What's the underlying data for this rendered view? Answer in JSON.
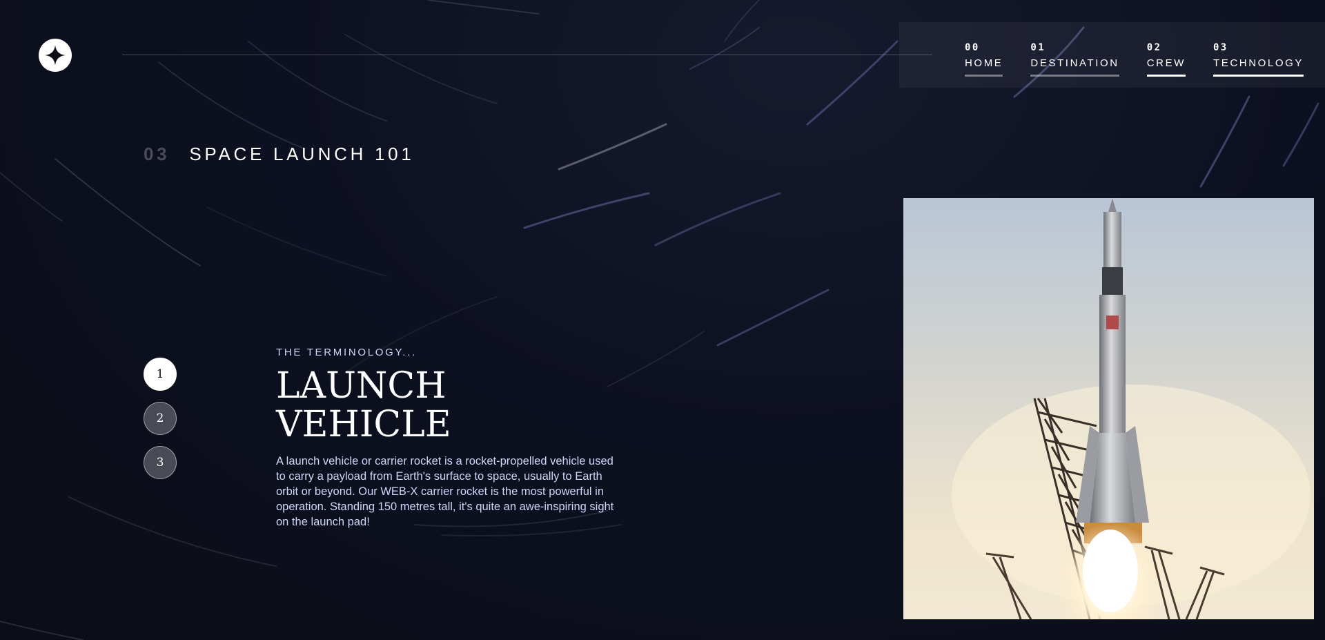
{
  "header": {
    "logo_icon": "star-icon"
  },
  "nav": {
    "items": [
      {
        "num": "00",
        "label": "HOME",
        "state": "dim"
      },
      {
        "num": "01",
        "label": "DESTINATION",
        "state": "dim"
      },
      {
        "num": "02",
        "label": "CREW",
        "state": "active"
      },
      {
        "num": "03",
        "label": "TECHNOLOGY",
        "state": "active"
      }
    ]
  },
  "page": {
    "index": "03",
    "heading": "SPACE LAUNCH 101"
  },
  "steps": [
    {
      "label": "1",
      "active": true
    },
    {
      "label": "2",
      "active": false
    },
    {
      "label": "3",
      "active": false
    }
  ],
  "content": {
    "eyebrow": "THE TERMINOLOGY...",
    "title": "LAUNCH VEHICLE",
    "description": "A launch vehicle or carrier rocket is a rocket-propelled vehicle used to carry a payload from Earth's surface to space, usually to Earth orbit or beyond. Our WEB-X carrier rocket is the most powerful in operation. Standing 150 metres tall, it's quite an awe-inspiring sight on the launch pad!"
  },
  "colors": {
    "background": "#0b0d17",
    "text": "#ffffff",
    "accent": "#d0d6f9"
  }
}
